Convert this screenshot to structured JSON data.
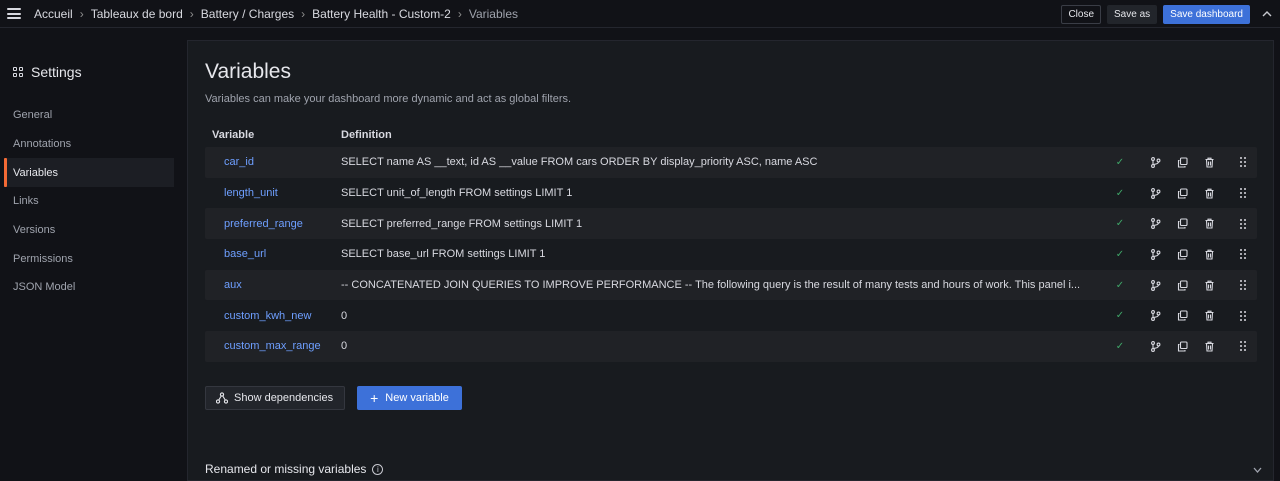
{
  "breadcrumb": {
    "items": [
      "Accueil",
      "Tableaux de bord",
      "Battery / Charges",
      "Battery Health - Custom-2",
      "Variables"
    ]
  },
  "toolbar": {
    "close_label": "Close",
    "save_as_label": "Save as",
    "save_dashboard_label": "Save dashboard"
  },
  "sidebar": {
    "title": "Settings",
    "items": [
      {
        "label": "General"
      },
      {
        "label": "Annotations"
      },
      {
        "label": "Variables",
        "active": true
      },
      {
        "label": "Links"
      },
      {
        "label": "Versions"
      },
      {
        "label": "Permissions"
      },
      {
        "label": "JSON Model"
      }
    ]
  },
  "main": {
    "title": "Variables",
    "description": "Variables can make your dashboard more dynamic and act as global filters.",
    "columns": {
      "variable": "Variable",
      "definition": "Definition"
    },
    "rows": [
      {
        "name": "car_id",
        "definition": "SELECT name AS __text, id AS __value FROM cars ORDER BY display_priority ASC, name ASC"
      },
      {
        "name": "length_unit",
        "definition": "SELECT unit_of_length FROM settings LIMIT 1"
      },
      {
        "name": "preferred_range",
        "definition": "SELECT preferred_range FROM settings LIMIT 1"
      },
      {
        "name": "base_url",
        "definition": "SELECT base_url FROM settings LIMIT 1"
      },
      {
        "name": "aux",
        "definition": "-- CONCATENATED JOIN QUERIES TO IMPROVE PERFORMANCE -- The following query is the result of many tests and hours of work. This panel i..."
      },
      {
        "name": "custom_kwh_new",
        "definition": "0"
      },
      {
        "name": "custom_max_range",
        "definition": "0"
      }
    ],
    "show_dependencies_label": "Show dependencies",
    "new_variable_label": "New variable",
    "renamed_label": "Renamed or missing variables"
  },
  "colors": {
    "accent": "#3d71d9",
    "active_marker": "#f46a35",
    "link": "#6e9fff",
    "check": "#3fa668"
  }
}
